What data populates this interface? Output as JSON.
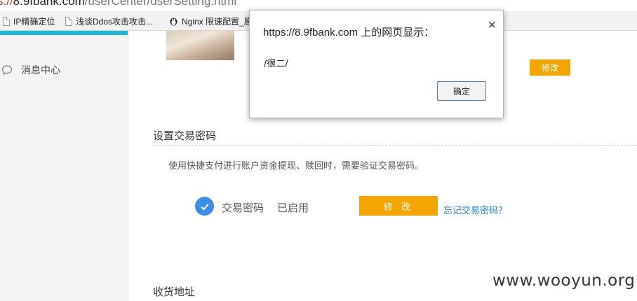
{
  "browser": {
    "address": {
      "scheme": "s://",
      "host": "8.9fbank.com",
      "path": "/userCenter/userSetting.html"
    },
    "bookmarks": [
      {
        "label": "IP精确定位",
        "icon": "page-icon"
      },
      {
        "label": "浅谈Ddos攻击攻击...",
        "icon": "page-icon"
      },
      {
        "label": "Nginx 限速配置_股",
        "icon": "penguin-icon"
      }
    ]
  },
  "sidebar": {
    "items": [
      {
        "label": "消息中心",
        "icon": "chat-bubble-icon"
      }
    ]
  },
  "profile": {
    "modify_label": "修改"
  },
  "trade_password": {
    "section_title": "设置交易密码",
    "description": "使用快捷支付进行账户资金提现、赎回时，需要验证交易密码。",
    "label": "交易密码",
    "status": "已启用",
    "modify_label": "修 改",
    "forgot_link": "忘记交易密码？"
  },
  "address_section": {
    "title": "收货地址"
  },
  "dialog": {
    "title": "https://8.9fbank.com 上的网页显示：",
    "close": "×",
    "message": "/很二/",
    "ok_label": "确定"
  },
  "watermark": "www.wooyun.org",
  "colors": {
    "accent": "#1fb8d2",
    "button": "#f5a500",
    "check": "#3a8ee6",
    "link": "#1a7ec9"
  }
}
